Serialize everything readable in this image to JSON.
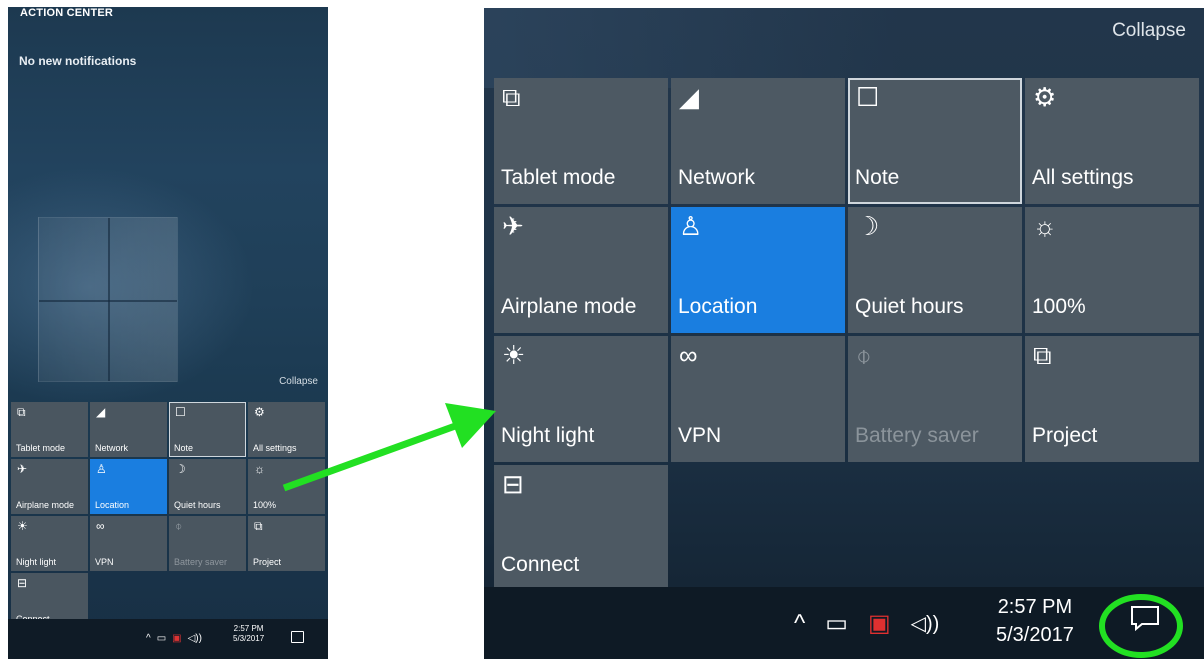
{
  "small_panel": {
    "title": "ACTION CENTER",
    "no_notifications": "No new notifications",
    "collapse": "Collapse",
    "tiles": [
      {
        "icon": "tablet-mode-icon",
        "glyph": "⧉",
        "label": "Tablet mode",
        "state": "normal"
      },
      {
        "icon": "network-icon",
        "glyph": "◢",
        "label": "Network",
        "state": "normal"
      },
      {
        "icon": "note-icon",
        "glyph": "☐",
        "label": "Note",
        "state": "outlined"
      },
      {
        "icon": "gear-icon",
        "glyph": "⚙",
        "label": "All settings",
        "state": "normal"
      },
      {
        "icon": "airplane-icon",
        "glyph": "✈",
        "label": "Airplane mode",
        "state": "normal"
      },
      {
        "icon": "location-icon",
        "glyph": "♙",
        "label": "Location",
        "state": "active"
      },
      {
        "icon": "moon-icon",
        "glyph": "☽",
        "label": "Quiet hours",
        "state": "normal"
      },
      {
        "icon": "brightness-icon",
        "glyph": "☼",
        "label": "100%",
        "state": "normal"
      },
      {
        "icon": "night-light-icon",
        "glyph": "☀",
        "label": "Night light",
        "state": "normal"
      },
      {
        "icon": "vpn-icon",
        "glyph": "∞",
        "label": "VPN",
        "state": "normal"
      },
      {
        "icon": "battery-saver-icon",
        "glyph": "⌽",
        "label": "Battery saver",
        "state": "dim"
      },
      {
        "icon": "project-icon",
        "glyph": "⧉",
        "label": "Project",
        "state": "normal"
      },
      {
        "icon": "connect-icon",
        "glyph": "⊟",
        "label": "Connect",
        "state": "normal"
      }
    ],
    "clock_time": "2:57 PM",
    "clock_date": "5/3/2017"
  },
  "zoom_panel": {
    "collapse": "Collapse",
    "tiles": [
      {
        "icon": "tablet-mode-icon",
        "glyph": "⧉",
        "label": "Tablet mode",
        "state": "normal"
      },
      {
        "icon": "network-icon",
        "glyph": "◢",
        "label": "Network",
        "state": "normal"
      },
      {
        "icon": "note-icon",
        "glyph": "☐",
        "label": "Note",
        "state": "outlined"
      },
      {
        "icon": "gear-icon",
        "glyph": "⚙",
        "label": "All settings",
        "state": "normal"
      },
      {
        "icon": "airplane-icon",
        "glyph": "✈",
        "label": "Airplane mode",
        "state": "normal"
      },
      {
        "icon": "location-icon",
        "glyph": "♙",
        "label": "Location",
        "state": "active"
      },
      {
        "icon": "moon-icon",
        "glyph": "☽",
        "label": "Quiet hours",
        "state": "normal"
      },
      {
        "icon": "brightness-icon",
        "glyph": "☼",
        "label": "100%",
        "state": "normal"
      },
      {
        "icon": "night-light-icon",
        "glyph": "☀",
        "label": "Night light",
        "state": "normal"
      },
      {
        "icon": "vpn-icon",
        "glyph": "∞",
        "label": "VPN",
        "state": "normal"
      },
      {
        "icon": "battery-saver-icon",
        "glyph": "⌽",
        "label": "Battery saver",
        "state": "dim"
      },
      {
        "icon": "project-icon",
        "glyph": "⧉",
        "label": "Project",
        "state": "normal"
      },
      {
        "icon": "connect-icon",
        "glyph": "⊟",
        "label": "Connect",
        "state": "normal"
      }
    ],
    "clock_time": "2:57 PM",
    "clock_date": "5/3/2017"
  },
  "tray": {
    "chevron_glyph": "^",
    "power_glyph": "▭",
    "network_glyph": "▣",
    "volume_glyph": "◁))"
  },
  "colors": {
    "active_tile": "#1a7ee0",
    "tile": "#4d5963",
    "annotation": "#22e022"
  }
}
